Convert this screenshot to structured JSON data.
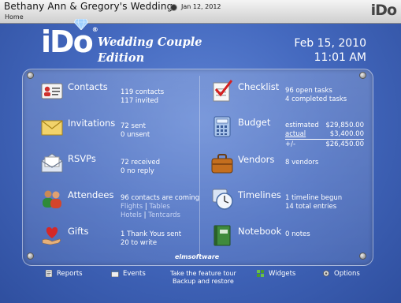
{
  "titlebar": {
    "title": "Bethany Ann & Gregory's Wedding",
    "date": "Jan 12, 2012",
    "breadcrumb": "Home",
    "logo": "iDo"
  },
  "branding": {
    "logo": "iDo",
    "reg": "®",
    "edition_line1": "Wedding Couple",
    "edition_line2": "Edition"
  },
  "datetime": {
    "date": "Feb 15, 2010",
    "time": "11:01 AM"
  },
  "left": {
    "contacts": {
      "label": "Contacts",
      "line1": "119 contacts",
      "line2": "117 invited"
    },
    "invitations": {
      "label": "Invitations",
      "line1": "72 sent",
      "line2": "0 unsent"
    },
    "rsvps": {
      "label": "RSVPs",
      "line1": "72 received",
      "line2": "0 no reply"
    },
    "attendees": {
      "label": "Attendees",
      "line1": "96 contacts are coming",
      "flights": "Flights",
      "sep": "|",
      "tables": "Tables",
      "hotels": "Hotels",
      "tentcards": "Tentcards"
    },
    "gifts": {
      "label": "Gifts",
      "line1": "1 Thank Yous sent",
      "line2": "20 to write"
    }
  },
  "right": {
    "checklist": {
      "label": "Checklist",
      "line1": "96 open tasks",
      "line2": "4 completed tasks"
    },
    "budget": {
      "label": "Budget",
      "estimated_label": "estimated",
      "estimated": "$29,850.00",
      "actual_label": "actual",
      "actual": "$3,400.00",
      "diff_label": "+/-",
      "diff": "$26,450.00"
    },
    "vendors": {
      "label": "Vendors",
      "line1": "8 vendors"
    },
    "timelines": {
      "label": "Timelines",
      "line1": "1 timeline begun",
      "line2": "14 total entries"
    },
    "notebook": {
      "label": "Notebook",
      "line1": "0 notes"
    }
  },
  "panel_brand": "elmsoftware",
  "footer": {
    "reports": "Reports",
    "events": "Events",
    "tour_line1": "Take the feature tour",
    "tour_line2": "Backup and restore",
    "widgets": "Widgets",
    "options": "Options"
  },
  "colors": {
    "background": "#3a5db3",
    "panel": "#6a8ad6",
    "accent_red": "#cc2020"
  }
}
